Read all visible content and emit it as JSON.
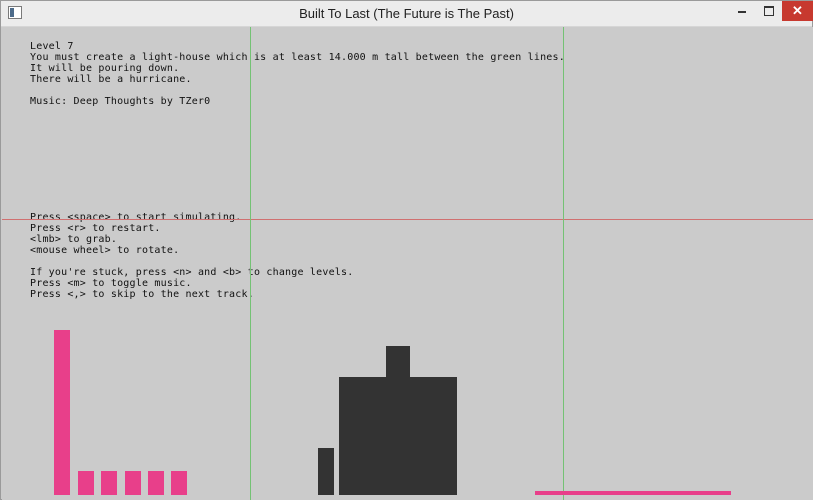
{
  "window": {
    "title": "Built To Last (The Future is The Past)"
  },
  "level_info": [
    "Level 7",
    "You must create a light-house which is at least 14.000 m tall between the green lines.",
    "It will be pouring down.",
    "There will be a hurricane.",
    "",
    "Music: Deep Thoughts by TZer0"
  ],
  "instructions": [
    "Press <space> to start simulating.",
    "Press <r> to restart.",
    "<lmb> to grab.",
    "<mouse wheel> to rotate.",
    "",
    "If you're stuck, press <n> and <b> to change levels.",
    "Press <m> to toggle music.",
    "Press <,> to skip to the next track."
  ],
  "colors": {
    "background": "#cbcbcb",
    "guide_green": "#74c274",
    "target_red": "#d07070",
    "pink_block": "#e83f8a",
    "dark_block": "#333333"
  }
}
